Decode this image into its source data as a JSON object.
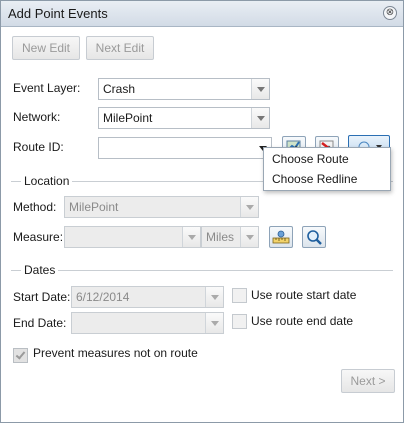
{
  "window": {
    "title": "Add Point Events",
    "close_glyph": "⊗"
  },
  "toolbar": {
    "new_edit_label": "New Edit",
    "next_edit_label": "Next Edit"
  },
  "form": {
    "event_layer_label": "Event Layer:",
    "event_layer_value": "Crash",
    "network_label": "Network:",
    "network_value": "MilePoint",
    "route_id_label": "Route ID:",
    "route_id_value": ""
  },
  "route_menu": {
    "items": [
      "Choose Route",
      "Choose Redline"
    ]
  },
  "location": {
    "section_title": "Location",
    "method_label": "Method:",
    "method_value": "MilePoint",
    "measure_label": "Measure:",
    "measure_value": "",
    "units_value": "Miles"
  },
  "dates": {
    "section_title": "Dates",
    "start_date_label": "Start Date:",
    "start_date_value": "6/12/2014",
    "use_route_start_label": "Use route start date",
    "end_date_label": "End Date:",
    "end_date_value": "",
    "use_route_end_label": "Use route end date"
  },
  "prevent_measures_label": "Prevent measures not on route",
  "footer": {
    "next_label": "Next >"
  },
  "icons": {
    "select_route_map": "map-route-select-icon",
    "select_redline": "redline-select-icon",
    "route_options": "route-options-icon",
    "measure_on_map": "measure-ruler-icon",
    "zoom_to": "zoom-magnifier-icon"
  },
  "colors": {
    "title_bar": "#d2dbe6",
    "accent_blue": "#2b6fb3"
  }
}
